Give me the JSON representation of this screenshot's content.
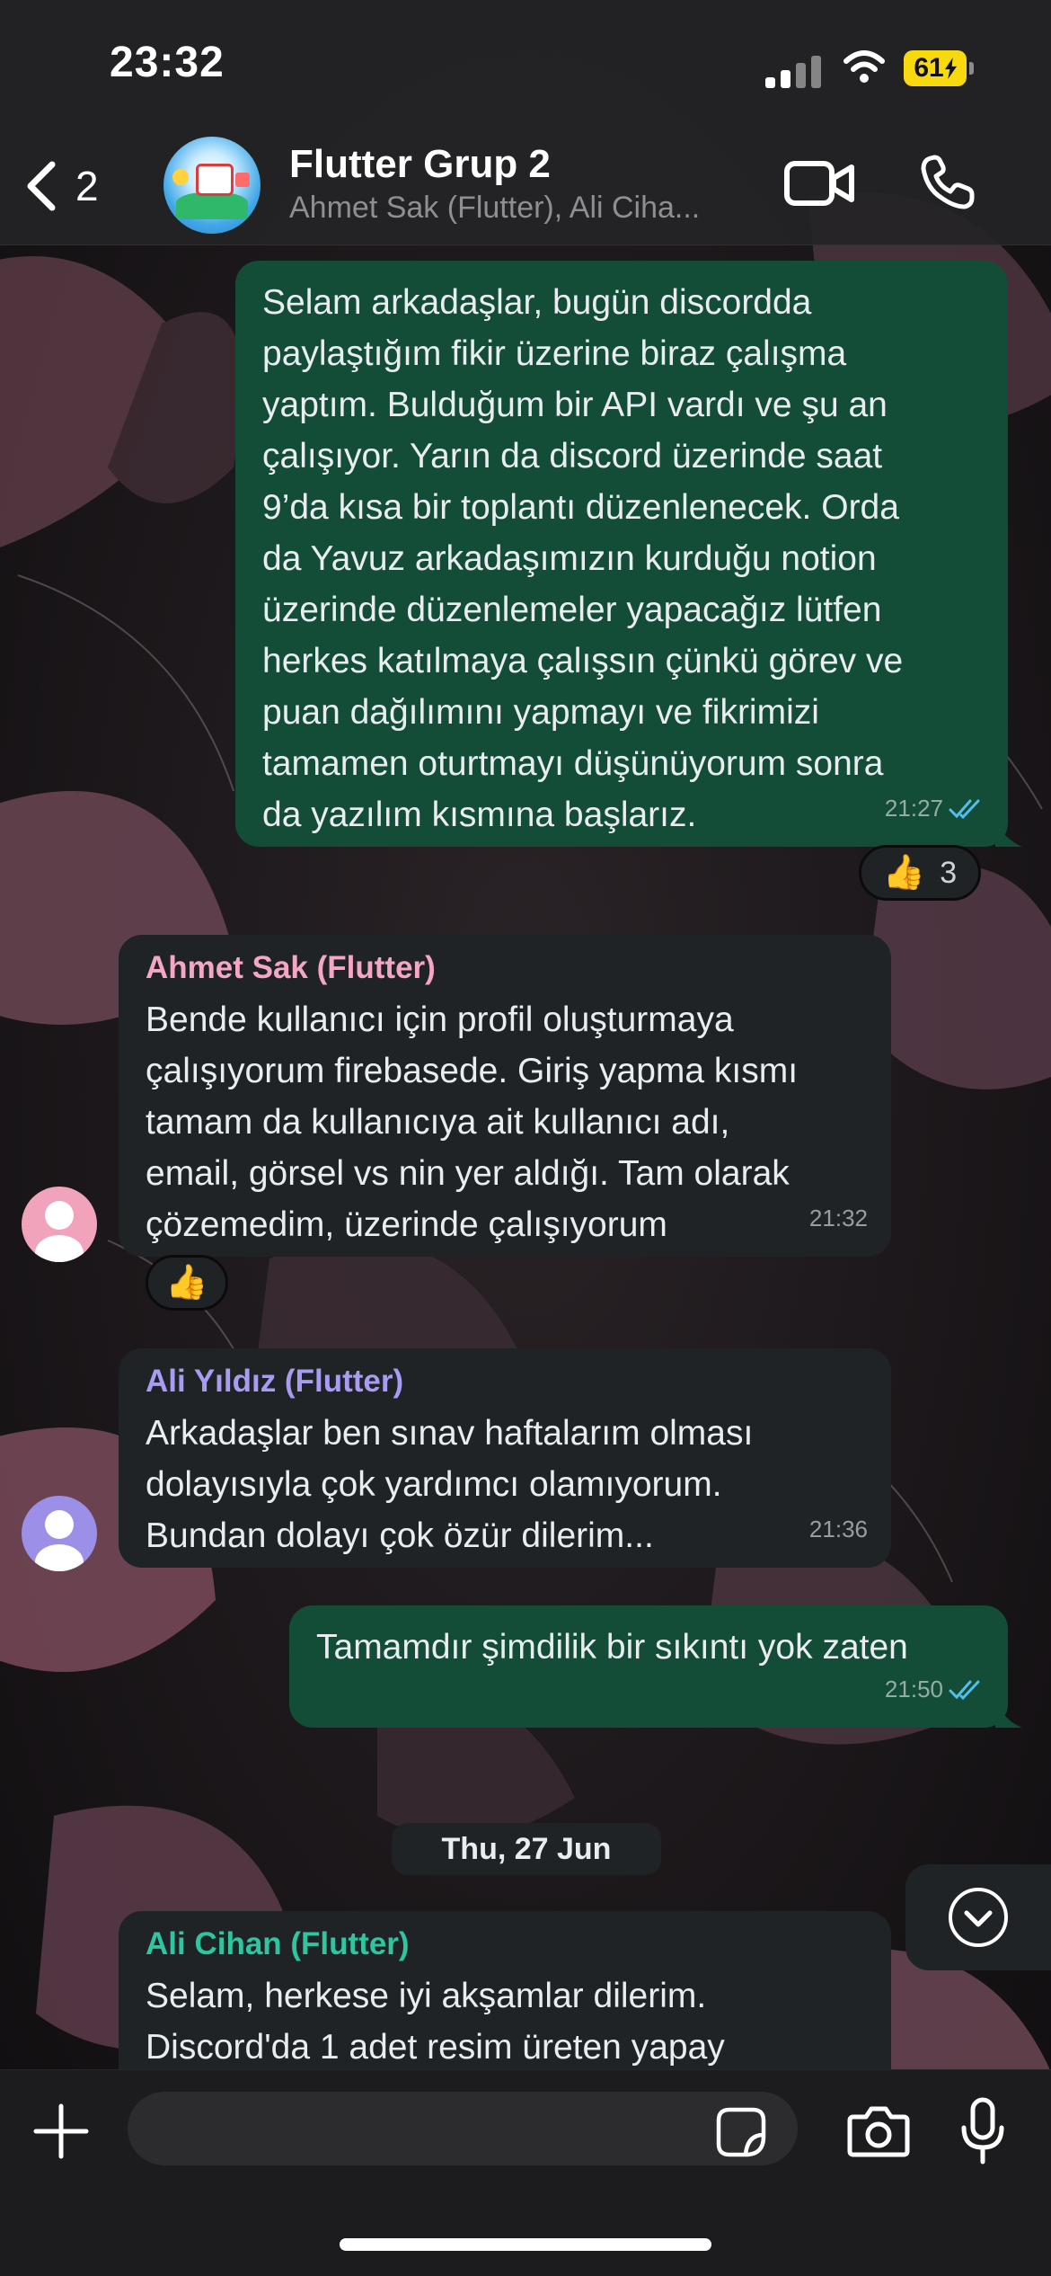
{
  "status_bar": {
    "time": "23:32",
    "battery": "61"
  },
  "header": {
    "back_count": "2",
    "title": "Flutter Grup 2",
    "subtitle": "Ahmet Sak (Flutter), Ali Ciha..."
  },
  "messages": [
    {
      "direction": "outgoing",
      "text": "Selam arkadaşlar, bugün discordda\npaylaştığım fikir üzerine biraz çalışma\nyaptım. Bulduğum bir API vardı ve şu an\nçalışıyor. Yarın da discord üzerinde saat\n9’da kısa bir toplantı düzenlenecek. Orda\nda Yavuz arkadaşımızın kurduğu notion\nüzerinde düzenlemeler yapacağız lütfen\nherkes katılmaya çalışsın çünkü görev ve\npuan dağılımını yapmayı ve fikrimizi\ntamamen oturtmayı düşünüyorum sonra\nda yazılım kısmına başlarız.",
      "time": "21:27",
      "reaction": {
        "emoji": "👍",
        "count": "3"
      }
    },
    {
      "direction": "incoming",
      "sender": "Ahmet Sak (Flutter)",
      "sender_color": "#f5a6c6",
      "avatar_color": "#f0a3bb",
      "text": "Bende kullanıcı için profil oluşturmaya\nçalışıyorum firebasede. Giriş yapma kısmı\ntamam da kullanıcıya ait kullanıcı adı,\nemail, görsel vs nin yer aldığı. Tam olarak\nçözemedim, üzerinde çalışıyorum",
      "time": "21:32",
      "reaction": {
        "emoji": "👍"
      }
    },
    {
      "direction": "incoming",
      "sender": "Ali Yıldız (Flutter)",
      "sender_color": "#a79cf2",
      "avatar_color": "#9c8fe8",
      "text": "Arkadaşlar ben sınav haftalarım olması\ndolayısıyla çok yardımcı olamıyorum.\nBundan dolayı çok özür dilerim...",
      "time": "21:36"
    },
    {
      "direction": "outgoing",
      "text": "Tamamdır şimdilik bir sıkıntı yok zaten",
      "time": "21:50"
    },
    {
      "direction": "incoming",
      "sender": "Ali Cihan (Flutter)",
      "sender_color": "#2ec5a0",
      "text": "Selam, herkese iyi akşamlar dilerim.\nDiscord'da 1 adet resim üreten yapay"
    }
  ],
  "date_separator": "Thu, 27 Jun",
  "icons": {
    "back": "chevron-left-icon",
    "video": "video-camera-icon",
    "call": "phone-icon",
    "scroll": "chevron-down-circle-icon",
    "attach": "plus-icon",
    "sticker": "sticker-icon",
    "camera": "camera-icon",
    "mic": "microphone-icon",
    "read": "double-check-icon"
  },
  "colors": {
    "outgoing_bubble": "#134d37",
    "incoming_bubble": "#1f2326",
    "read_receipt": "#53bdeb",
    "battery": "#f8d90f"
  }
}
